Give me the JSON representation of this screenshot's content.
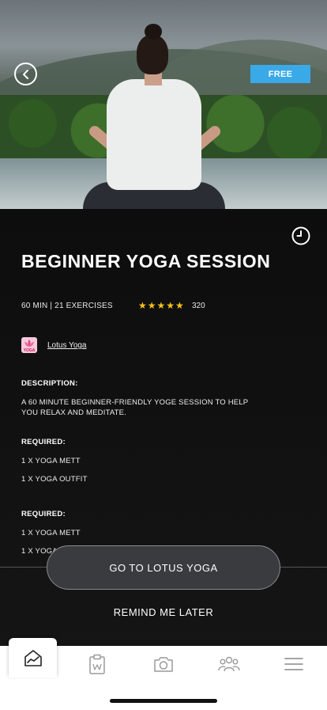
{
  "header": {
    "badge": "FREE"
  },
  "session": {
    "title": "BEGINNER YOGA SESSION",
    "meta": "60 MIN | 21 EXERCISES",
    "rating": 5,
    "stars": "★★★★★",
    "rating_count": "320",
    "brand_name": "Lotus Yoga",
    "brand_logo_text": "YOGA"
  },
  "description": {
    "heading": "DESCRIPTION:",
    "text": "A 60 MINUTE BEGINNER-FRIENDLY YOGE SESSION TO HELP YOU RELAX AND MEDITATE."
  },
  "required_1": {
    "heading": "REQUIRED:",
    "items": [
      "1 X YOGA METT",
      "1 X YOGA OUTFIT"
    ]
  },
  "required_2": {
    "heading": "REQUIRED:",
    "items": [
      "1 X YOGA METT",
      "1 X YOGA"
    ]
  },
  "actions": {
    "primary": "GO TO LOTUS YOGA",
    "secondary": "REMIND ME LATER"
  },
  "tabbar": {
    "active": "home",
    "icons": [
      "home-chart-icon",
      "clipboard-icon",
      "camera-icon",
      "group-icon",
      "menu-icon"
    ]
  },
  "colors": {
    "badge": "#3aa9e8",
    "stars": "#f4c21b",
    "background": "#111111"
  }
}
